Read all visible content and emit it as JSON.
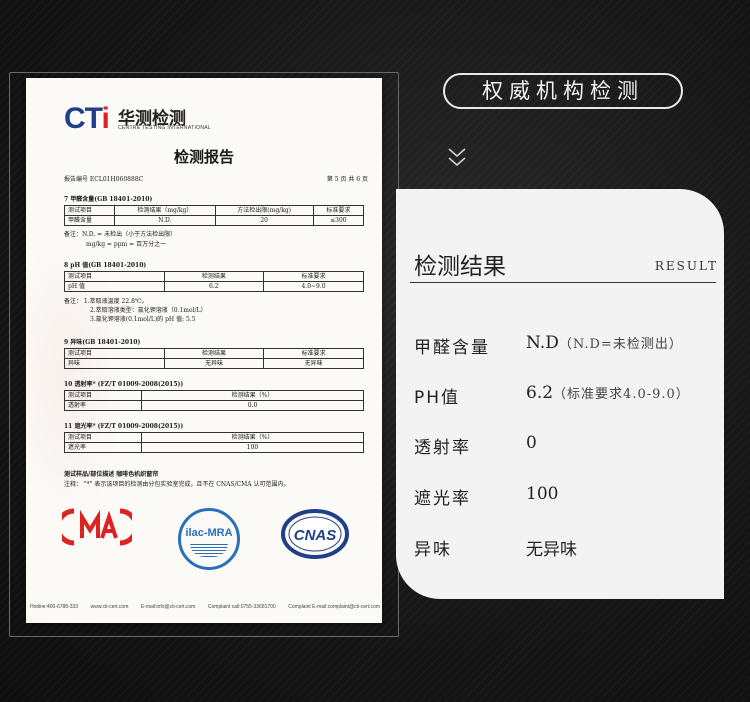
{
  "doc": {
    "logo_text": "CTi",
    "logo_cn": "华测检测",
    "logo_en": "CENTRE TESTING INTERNATIONAL",
    "title": "检测报告",
    "report_no": "报告编号    ECL01H060888C",
    "page": "第 5 页  共 6 页",
    "sec7": "7   甲醛含量(GB 18401-2010)",
    "t7_head": [
      "测试项目",
      "检测结果（mg/kg）",
      "方法检出限(mg/kg)",
      "标准要求"
    ],
    "t7_row": [
      "甲醛含量",
      "N.D.",
      "20",
      "≤300"
    ],
    "note7": [
      "备注：N.D. = 未检出（小于方法检出限）",
      "mg/kg = ppm = 百万分之一"
    ],
    "sec8": "8   pH 值(GB 18401-2010)",
    "t8_head": [
      "测试项目",
      "检测结果",
      "标准要求"
    ],
    "t8_row": [
      "pH 值",
      "6.2",
      "4.0~9.0"
    ],
    "note8": [
      "备注：  1.萃取液温度 22.8℃。",
      "2.萃取溶液类型：氯化钾溶液（0.1mol/L）",
      "3.氯化钾溶液(0.1mol/L)的 pH 值: 5.5"
    ],
    "sec9": "9   异味(GB 18401-2010)",
    "t9_head": [
      "测试项目",
      "检测结果",
      "标准要求"
    ],
    "t9_row": [
      "异味",
      "无异味",
      "无异味"
    ],
    "sec10": "10   透射率* (FZ/T 01009-2008(2015))",
    "t10_head": [
      "测试项目",
      "检测结果（%）"
    ],
    "t10_row": [
      "透射率",
      "0.0"
    ],
    "sec11": "11   遮光率* (FZ/T 01009-2008(2015))",
    "t11_head": [
      "测试项目",
      "检测结果（%）"
    ],
    "t11_row": [
      "遮光率",
      "100"
    ],
    "sample": "测试样品/部位描述      咖啡色机织窗帘",
    "remark": "注释：  \"*\" 表示该项目的检测由分包实验室完成，且不在 CNAS/CMA 认可范围内。",
    "seal_cma": "CMA",
    "seal_ilac": "ilac-MRA",
    "seal_cnas": "CNAS",
    "footer": [
      "Hotline:400-6788-333",
      "www.cti-cert.com",
      "E-mail:info@cti-cert.com",
      "Complaint call:0755-33681700",
      "Complaint E-mail:complaint@cti-cert.com"
    ]
  },
  "heading": "权威机构检测",
  "panel": {
    "title": "检测结果",
    "tag": "RESULT",
    "rows": [
      {
        "label": "甲醛含量",
        "value": "N.D",
        "note": "（N.D=未检测出）"
      },
      {
        "label": "PH值",
        "value": "6.2",
        "note": "（标准要求4.0-9.0）"
      },
      {
        "label": "透射率",
        "value": "0",
        "note": ""
      },
      {
        "label": "遮光率",
        "value": "100",
        "note": ""
      },
      {
        "label": "异味",
        "value": "无异味",
        "note": ""
      }
    ]
  },
  "colors": {
    "brand_blue": "#1f3f8a",
    "seal_red": "#d22",
    "ilac_blue": "#2a6fb8",
    "panel_bg": "#f3f3f3"
  }
}
